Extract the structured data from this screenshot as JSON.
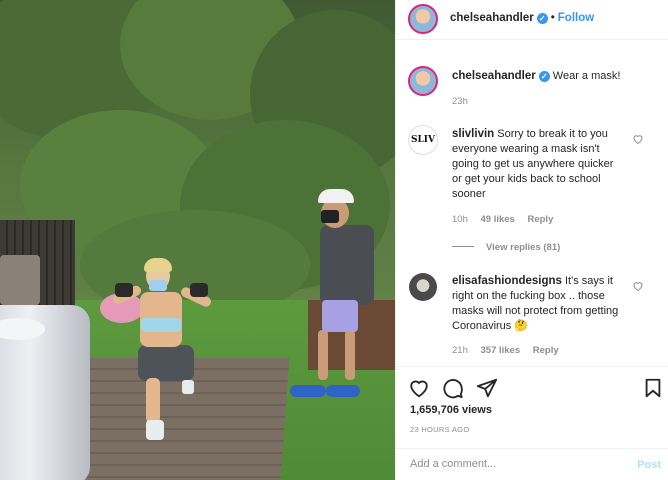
{
  "post": {
    "author": "chelseahandler",
    "follow_label": "Follow",
    "separator": "•",
    "caption": {
      "username": "chelseahandler",
      "text": "Wear a mask!",
      "time": "23h"
    }
  },
  "comments": [
    {
      "username": "slivlivin",
      "avatar_text": "SLIV",
      "text": "Sorry to break it to you everyone wearing a mask isn't going to get us anywhere quicker or get your kids back to school sooner",
      "time": "10h",
      "likes": "49 likes",
      "reply_label": "Reply",
      "view_replies": "View replies (81)"
    },
    {
      "username": "elisafashiondesigns",
      "text": "It's says it right on the fucking box .. those masks will not protect from getting Coronavirus 🤔",
      "time": "21h",
      "likes": "357 likes",
      "reply_label": "Reply"
    }
  ],
  "stats": {
    "views": "1,659,706 views",
    "time_ago": "23 HOURS AGO"
  },
  "comment_box": {
    "placeholder": "Add a comment...",
    "post_label": "Post"
  },
  "colors": {
    "accent": "#3897f0",
    "post_disabled": "#b2dffc",
    "muted": "#8e8e8e"
  },
  "icons": [
    "verified-badge-icon",
    "heart-icon",
    "comment-icon",
    "share-icon",
    "save-icon"
  ]
}
